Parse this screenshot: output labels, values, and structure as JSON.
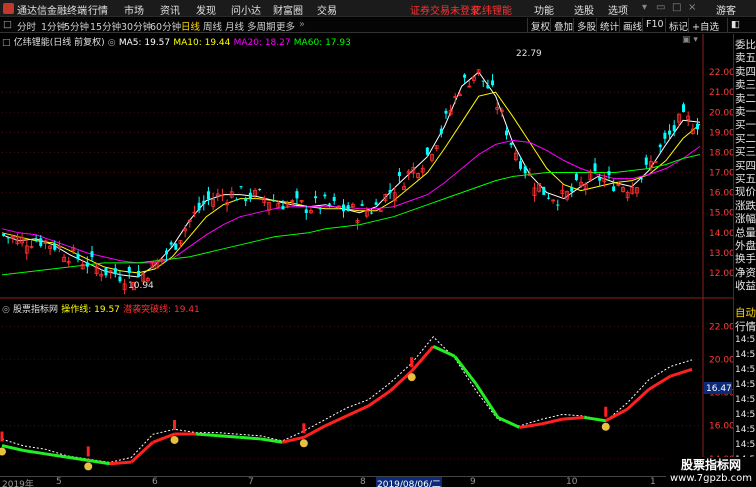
{
  "app_title": "通达信金融终端",
  "menu": [
    "行情",
    "市场",
    "资讯",
    "发现",
    "问小达",
    "财富圈",
    "交易"
  ],
  "menu_alert": "证券交易未登录",
  "menu_stock": "亿纬锂能",
  "menu_right": [
    "功能",
    "选股",
    "选项"
  ],
  "guest": "游客",
  "periods": [
    "分时",
    "1分钟",
    "5分钟",
    "15分钟",
    "30分钟",
    "60分钟",
    "日线",
    "周线",
    "月线",
    "多周期",
    "更多"
  ],
  "active_period": "日线",
  "right_buttons": [
    "复权",
    "叠加",
    "多股",
    "统计",
    "画线",
    "F10",
    "标记",
    "+自选"
  ],
  "main_legend": {
    "stock": "亿纬锂能(日线 前复权)",
    "ma5": "MA5: 19.57",
    "ma10": "MA10: 19.44",
    "ma20": "MA20: 18.27",
    "ma60": "MA60: 17.93"
  },
  "indicator_legend": {
    "name": "股票指标网",
    "line1": "操作线: 19.57",
    "line2": "潜袭突破线: 19.41"
  },
  "annotations": {
    "high": "22.79",
    "low": "10.94",
    "ind_value": "16.47"
  },
  "side_items": [
    "委比",
    "卖五",
    "卖四",
    "卖三",
    "卖二",
    "卖一",
    "买一",
    "买二",
    "买三",
    "买四",
    "买五",
    "现价",
    "涨跌",
    "涨幅",
    "总量",
    "外盘",
    "换手",
    "净资",
    "收益"
  ],
  "side_tab": "自动",
  "side_tab2": "行情",
  "side_times": [
    "14:5",
    "14:5",
    "14:5",
    "14:5",
    "14:5",
    "14:5",
    "14:5",
    "14:5",
    "14:5"
  ],
  "dates": [
    "2019年",
    "5",
    "6",
    "7",
    "8",
    "2019/08/06/二",
    "9",
    "10",
    "1"
  ],
  "watermark": {
    "line1": "股票指标网",
    "line2": "www.7gpzb.com"
  },
  "colors": {
    "up": "#ff3232",
    "down": "#00ffff",
    "ma5": "#ffffff",
    "ma10": "#ffff00",
    "ma20": "#ff00ff",
    "ma60": "#00ff00"
  },
  "chart_data": [
    {
      "type": "candlestick",
      "title": "亿纬锂能(日线 前复权)",
      "yticks": [
        12.0,
        13.0,
        14.0,
        15.0,
        16.0,
        17.0,
        18.0,
        19.0,
        20.0,
        21.0,
        22.0
      ],
      "ylim": [
        11.2,
        23.5
      ],
      "series": [
        {
          "name": "MA5",
          "values": [
            13.9,
            13.6,
            13.7,
            13.4,
            12.9,
            12.5,
            12.1,
            11.9,
            11.8,
            12.4,
            13.3,
            14.6,
            15.6,
            15.9,
            15.9,
            15.8,
            15.6,
            15.4,
            15.3,
            15.4,
            15.2,
            15.0,
            15.3,
            16.2,
            17.0,
            17.8,
            19.3,
            21.3,
            22.0,
            20.8,
            18.5,
            16.9,
            16.0,
            15.7,
            16.3,
            16.8,
            16.5,
            16.3,
            17.1,
            18.4,
            19.6,
            19.5
          ]
        },
        {
          "name": "MA10",
          "values": [
            14.0,
            13.8,
            13.6,
            13.5,
            13.1,
            12.7,
            12.3,
            12.1,
            12.0,
            12.2,
            12.8,
            13.8,
            14.8,
            15.4,
            15.7,
            15.7,
            15.6,
            15.5,
            15.3,
            15.2,
            15.2,
            15.1,
            15.1,
            15.6,
            16.3,
            17.0,
            18.2,
            19.5,
            20.8,
            21.0,
            19.8,
            18.5,
            17.2,
            16.4,
            16.1,
            16.3,
            16.5,
            16.6,
            16.9,
            17.6,
            18.7,
            19.4
          ]
        },
        {
          "name": "MA20",
          "values": [
            14.2,
            14.0,
            13.9,
            13.6,
            13.3,
            13.0,
            12.8,
            12.6,
            12.5,
            12.5,
            12.7,
            13.3,
            13.9,
            14.4,
            14.8,
            15.0,
            15.2,
            15.3,
            15.3,
            15.3,
            15.3,
            15.2,
            15.2,
            15.3,
            15.6,
            15.9,
            16.5,
            17.2,
            17.9,
            18.4,
            18.6,
            18.5,
            18.1,
            17.6,
            17.2,
            16.9,
            16.7,
            16.7,
            16.9,
            17.2,
            17.7,
            18.3
          ]
        },
        {
          "name": "MA60",
          "values": [
            11.9,
            12.0,
            12.1,
            12.2,
            12.3,
            12.4,
            12.5,
            12.5,
            12.5,
            12.6,
            12.7,
            12.8,
            13.0,
            13.2,
            13.4,
            13.6,
            13.8,
            13.9,
            14.0,
            14.2,
            14.3,
            14.4,
            14.6,
            14.8,
            15.1,
            15.4,
            15.7,
            16.0,
            16.3,
            16.6,
            16.8,
            16.9,
            17.0,
            17.0,
            17.0,
            17.0,
            17.0,
            17.1,
            17.2,
            17.4,
            17.7,
            17.9
          ]
        }
      ]
    },
    {
      "type": "line",
      "title": "股票指标网",
      "yticks": [
        14.0,
        16.0,
        18.0,
        20.0,
        22.0
      ],
      "ylim": [
        13.2,
        23.0
      ],
      "series": [
        {
          "name": "操作线",
          "values": [
            15.0,
            14.6,
            14.4,
            14.0,
            13.8,
            13.6,
            13.9,
            15.3,
            15.6,
            15.4,
            15.4,
            15.3,
            15.2,
            14.9,
            15.5,
            16.2,
            16.9,
            17.4,
            18.4,
            19.6,
            21.2,
            19.9,
            17.9,
            16.2,
            15.8,
            16.2,
            16.5,
            16.4,
            16.1,
            17.2,
            18.6,
            19.4,
            19.8
          ]
        },
        {
          "name": "潜袭突破线",
          "values": [
            14.8,
            14.5,
            14.3,
            14.1,
            13.9,
            13.7,
            13.8,
            15.0,
            15.5,
            15.5,
            15.4,
            15.3,
            15.2,
            15.0,
            15.3,
            16.0,
            16.6,
            17.2,
            18.1,
            19.3,
            20.8,
            20.2,
            18.5,
            16.5,
            15.9,
            16.1,
            16.4,
            16.5,
            16.3,
            17.0,
            18.2,
            19.0,
            19.41
          ]
        }
      ]
    }
  ]
}
